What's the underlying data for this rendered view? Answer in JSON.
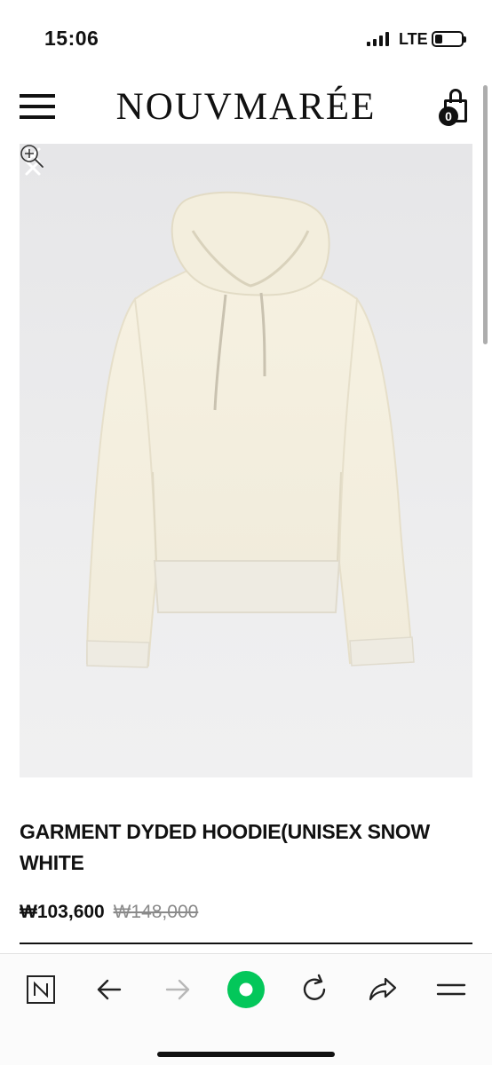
{
  "status_bar": {
    "time": "15:06",
    "network": "LTE",
    "battery_level": 0.3
  },
  "header": {
    "logo": "NOUVMARÉE",
    "cart_count": "0"
  },
  "product": {
    "title": "GARMENT DYDED HOODIE(UNISEX SNOW WHITE",
    "sale_price": "₩103,600",
    "original_price": "₩148,000",
    "image_color": "#f4efe0"
  },
  "browser_toolbar": {
    "items": [
      "naver-n-icon",
      "back-arrow-icon",
      "forward-arrow-icon",
      "green-home-icon",
      "refresh-icon",
      "share-icon",
      "menu-lines-icon"
    ],
    "accent": "#03c75a"
  }
}
